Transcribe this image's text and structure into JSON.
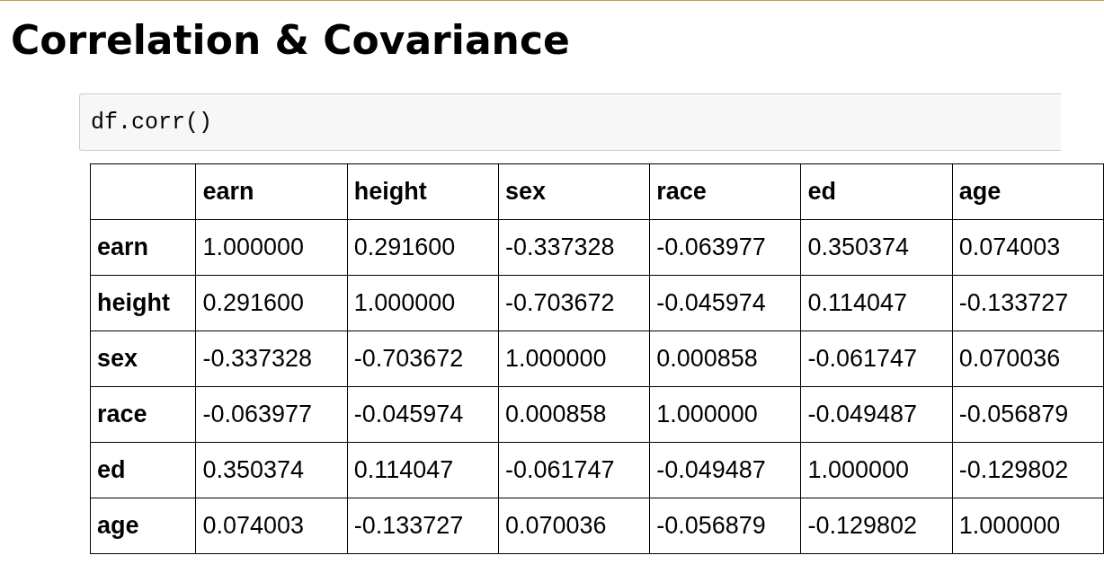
{
  "title": "Correlation & Covariance",
  "code_cell": {
    "code": "df.corr()"
  },
  "table": {
    "columns": [
      "earn",
      "height",
      "sex",
      "race",
      "ed",
      "age"
    ],
    "rows": [
      {
        "label": "earn",
        "cells": [
          "1.000000",
          "0.291600",
          "-0.337328",
          "-0.063977",
          "0.350374",
          "0.074003"
        ]
      },
      {
        "label": "height",
        "cells": [
          "0.291600",
          "1.000000",
          "-0.703672",
          "-0.045974",
          "0.114047",
          "-0.133727"
        ]
      },
      {
        "label": "sex",
        "cells": [
          "-0.337328",
          "-0.703672",
          "1.000000",
          "0.000858",
          "-0.061747",
          "0.070036"
        ]
      },
      {
        "label": "race",
        "cells": [
          "-0.063977",
          "-0.045974",
          "0.000858",
          "1.000000",
          "-0.049487",
          "-0.056879"
        ]
      },
      {
        "label": "ed",
        "cells": [
          "0.350374",
          "0.114047",
          "-0.061747",
          "-0.049487",
          "1.000000",
          "-0.129802"
        ]
      },
      {
        "label": "age",
        "cells": [
          "0.074003",
          "-0.133727",
          "0.070036",
          "-0.056879",
          "-0.129802",
          "1.000000"
        ]
      }
    ]
  }
}
